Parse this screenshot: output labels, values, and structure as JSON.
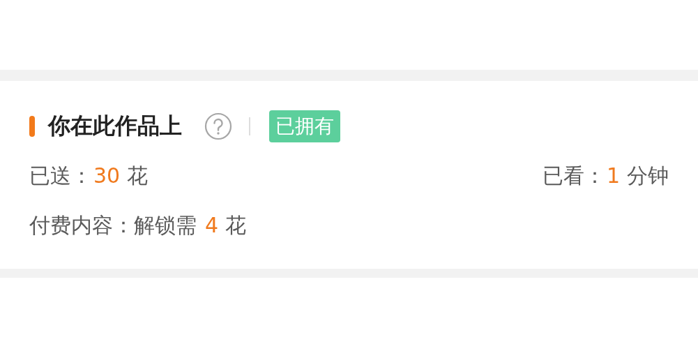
{
  "section": {
    "title": "你在此作品上",
    "help_icon": true,
    "badge": "已拥有"
  },
  "stats": [
    {
      "label": "已送：",
      "value": "30",
      "unit": "花"
    },
    {
      "label": "已看：",
      "value": "1",
      "unit": "分钟"
    }
  ],
  "paid": {
    "label": "付费内容：解锁需",
    "value": "4",
    "unit": "花"
  }
}
